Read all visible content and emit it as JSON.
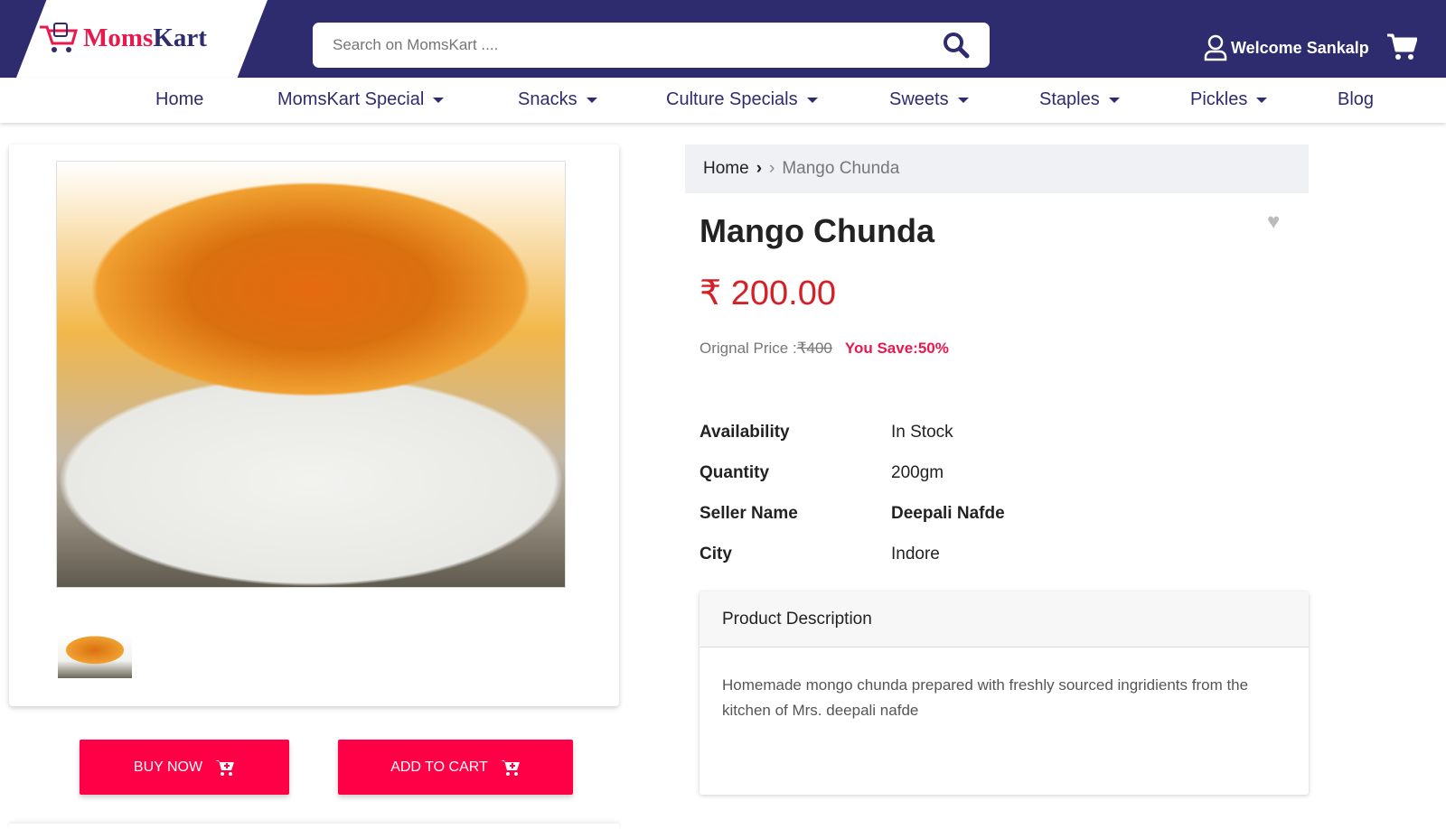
{
  "header": {
    "logo_text_1": "Moms",
    "logo_text_2": "Kart",
    "search_placeholder": "Search on MomsKart ....",
    "welcome": "Welcome Sankalp"
  },
  "nav": [
    {
      "label": "Home"
    },
    {
      "label": "MomsKart Special"
    },
    {
      "label": "Snacks"
    },
    {
      "label": "Culture Specials"
    },
    {
      "label": "Sweets"
    },
    {
      "label": "Staples"
    },
    {
      "label": "Pickles"
    },
    {
      "label": "Blog"
    }
  ],
  "breadcrumb": {
    "home": "Home",
    "current": "Mango Chunda"
  },
  "product": {
    "title": "Mango Chunda",
    "price": "₹ 200.00",
    "orig_label": "Orignal Price :",
    "orig_price": "₹400",
    "save": "You Save:50%",
    "specs": [
      {
        "label": "Availability",
        "value": "In Stock"
      },
      {
        "label": "Quantity",
        "value": "200gm"
      },
      {
        "label": "Seller Name",
        "value": "Deepali Nafde"
      },
      {
        "label": "City",
        "value": "Indore"
      }
    ],
    "desc_title": "Product Description",
    "description": "Homemade mongo chunda prepared with freshly sourced ingridients from the kitchen of Mrs. deepali nafde"
  },
  "buttons": {
    "buy": "BUY NOW",
    "add": "ADD TO CART"
  },
  "colors": {
    "brand": "#2e2b6e",
    "accent": "#ff0046",
    "price": "#d62028"
  }
}
